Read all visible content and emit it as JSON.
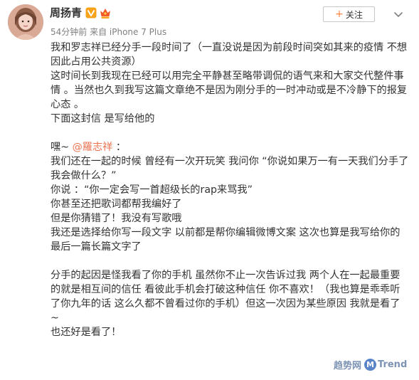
{
  "post": {
    "user_name": "周扬青",
    "meta": "54分钟前 来自 iPhone 7 Plus",
    "follow_label": "关注",
    "follow_plus": "+",
    "lines": [
      "我和罗志祥已经分手一段时间了（一直没说是因为前段时间突如其来的疫情 不想",
      "因此占用公共资源）",
      "这时间长到我现在已经可以用完全平静甚至略带调侃的语气来和大家交代整件事",
      "情 。当然也久到我写这篇文章绝不是因为刚分手的一时冲动或是不冷静下的报复",
      "心态 。",
      "下面这封信 是写给他的",
      "",
      "嘿~ @羅志祥 ：",
      "我们还在一起的时候 曾经有一次开玩笑 我问你 “你说如果万一有一天我们分手了",
      "我会做什么？”",
      "你说 ：“你一定会写一首超级长的rap来骂我”",
      "你甚至还把歌词都帮我编好了",
      "但是你猜错了！我没有写歌哦",
      "我还是选择给你写一段文字 以前都是帮你编辑微博文案 这次也算是我写给你的",
      "最后一篇长篇文字了",
      "",
      "分手的起因是怪我看了你的手机 虽然你不止一次告诉过我 两个人在一起最重要",
      "的就是相互间的信任 看彼此手机会打破这种信任 你不喜欢！（我也算是乖乖听",
      "了你九年的话 这么久都不曾看过你的手机）但这一次因为某些原因 我就是看了",
      "~",
      "也还好是看了！"
    ],
    "mention_prefix": "嘿~ ",
    "mention": "@羅志祥",
    "mention_suffix": " ："
  },
  "watermark": {
    "left_text": "趋势网",
    "logo_letter": "M",
    "right_text": "Trend"
  },
  "colors": {
    "mention": "#eb7350",
    "follow_plus": "#ff8140",
    "meta": "#808080",
    "verified": "#f7a21b",
    "vip": "#f05a28"
  },
  "icons": {
    "verified": "verified-v-icon",
    "vip": "vip-crown-icon",
    "more": "chevron-down-icon",
    "avatar": "avatar"
  }
}
